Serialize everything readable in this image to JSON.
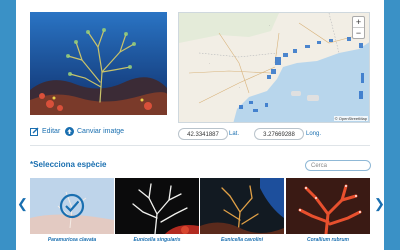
{
  "map": {
    "zoom_in": "+",
    "zoom_out": "−",
    "attribution": "© OpenStreetMap"
  },
  "actions": {
    "edit": "Editar",
    "change_image": "Canviar imatge"
  },
  "coords": {
    "lat_value": "42.3341887",
    "lat_label": "Lat.",
    "lon_value": "3.27669288",
    "lon_label": "Long."
  },
  "species_section": {
    "title": "*Selecciona espècie",
    "search_placeholder": "Cerca"
  },
  "nav": {
    "prev": "❮",
    "next": "❯"
  },
  "species": [
    {
      "name": "Paramuricea clavata",
      "selected": true
    },
    {
      "name": "Eunicella singularis",
      "selected": false
    },
    {
      "name": "Eunicella cavolini",
      "selected": false
    },
    {
      "name": "Corallium rubrum",
      "selected": false
    }
  ],
  "colors": {
    "accent": "#1a6fb0",
    "background": "#3a91c6"
  }
}
